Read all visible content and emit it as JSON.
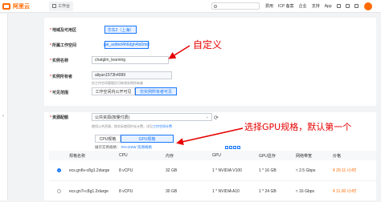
{
  "topbar": {
    "logo": "阿里云",
    "home": "工作台",
    "nav": [
      "费用",
      "ICP 备案",
      "企业",
      "支持",
      "App"
    ]
  },
  "form": {
    "region_label": "地域及可用区",
    "region_value": "华东2（上海）",
    "workspace_label": "所属工作空间",
    "workspace_value": "pai_added4h6dgh4ts0mol",
    "instance_label": "实例名称",
    "instance_value": "chatglm_learning",
    "owner_label": "实例所有者",
    "owner_value": "aliyun1573h4999",
    "owner_helper": "仅工作空间管理员可修改实例所有者",
    "visibility_label": "可见范围",
    "visibility_options": [
      "工作空间内公开可见",
      "仅实例所有者可见"
    ],
    "resource_label": "资源配额",
    "resource_value": "公共资源(按量付费)",
    "resource_helper_prefix": "使用公共资源，按实际使用时长计费，详见",
    "resource_helper_link": "工作空间计费",
    "resource_tabs": [
      "CPU规格",
      "GPU规格"
    ],
    "filter_text": "展示实例规格：",
    "filter_link": "PAI-DSW 资源规格"
  },
  "annotations": {
    "custom": "自定义",
    "gpu": "选择GPU规格，默认第一个"
  },
  "table": {
    "headers": [
      "规格名称",
      "CPU",
      "内存",
      "GPU",
      "GPU显存",
      "网络带宽",
      "价格"
    ],
    "rows": [
      {
        "name": "ecs.gn6v-c8g1.2xlarge",
        "cpu": "8 vCPU",
        "mem": "32 GB",
        "gpu": "1 * NVIDIA V100",
        "gpumem": "1 * 16 GB",
        "net": "≈ 2.5 Gbps",
        "price": "¥ 29.11 /小时",
        "selected": true
      },
      {
        "name": "ecs.gn7i-c8g1.2xlarge",
        "cpu": "8 vCPU",
        "mem": "30 GB",
        "gpu": "1 * NVIDIA A10",
        "gpumem": "1 * 24 GB",
        "net": "≈ 16 Gbps",
        "price": "¥ 11.00 /小时",
        "selected": false
      }
    ]
  }
}
